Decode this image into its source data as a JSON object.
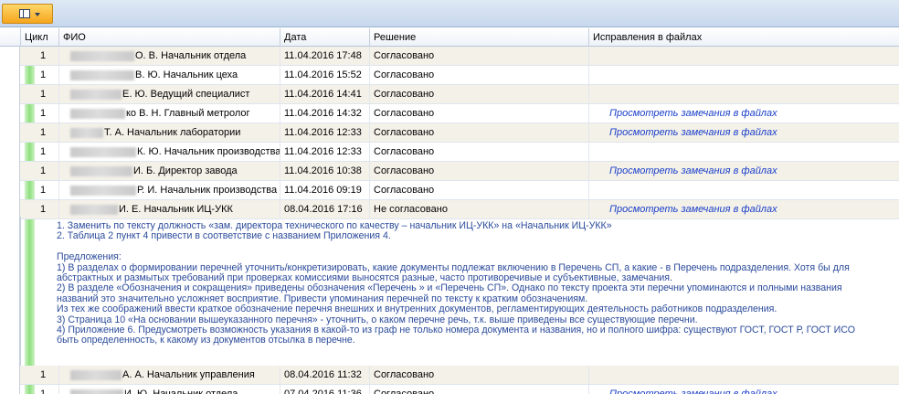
{
  "columns": {
    "cycle": "Цикл",
    "fio": "ФИО",
    "date": "Дата",
    "decision": "Решение",
    "fixes": "Исправления в файлах"
  },
  "rows": [
    {
      "cycle": "1",
      "fio": "О. В. Начальник отдела",
      "date": "11.04.2016 17:48",
      "decision": "Согласовано",
      "fix": ""
    },
    {
      "cycle": "1",
      "fio": "В. Ю. Начальник цеха",
      "date": "11.04.2016 15:52",
      "decision": "Согласовано",
      "fix": ""
    },
    {
      "cycle": "1",
      "fio": "Е. Ю. Ведущий специалист",
      "date": "11.04.2016 14:41",
      "decision": "Согласовано",
      "fix": ""
    },
    {
      "cycle": "1",
      "fio": "ко В. Н. Главный метролог",
      "date": "11.04.2016 14:32",
      "decision": "Согласовано",
      "fix": "Просмотреть замечания в файлах"
    },
    {
      "cycle": "1",
      "fio": "Т. А. Начальник лаборатории",
      "date": "11.04.2016 12:33",
      "decision": "Согласовано",
      "fix": "Просмотреть замечания в файлах"
    },
    {
      "cycle": "1",
      "fio": "К. Ю. Начальник производства",
      "date": "11.04.2016 12:33",
      "decision": "Согласовано",
      "fix": ""
    },
    {
      "cycle": "1",
      "fio": "И. Б. Директор завода",
      "date": "11.04.2016 10:38",
      "decision": "Согласовано",
      "fix": "Просмотреть замечания в файлах"
    },
    {
      "cycle": "1",
      "fio": "Р. И. Начальник производства",
      "date": "11.04.2016 09:19",
      "decision": "Согласовано",
      "fix": ""
    },
    {
      "cycle": "1",
      "fio": "И. Е. Начальник ИЦ-УКК",
      "date": "08.04.2016 17:16",
      "decision": "Не согласовано",
      "fix": "Просмотреть замечания в файлах"
    }
  ],
  "comment_lines": [
    "1. Заменить по тексту должность «зам. директора технического по качеству – начальник ИЦ-УКК» на «Начальник ИЦ-УКК»",
    "2. Таблица 2 пункт 4 привести в соответствие с названием Приложения 4.",
    "",
    "Предложения:",
    "1) В разделах о формировании перечней уточнить/конкретизировать, какие документы подлежат включению в Перечень СП, а какие - в Перечень подразделения. Хотя бы для",
    "абстрактных и размытых требований при проверках комиссиями выносятся разные, часто противоречивые и субъективные, замечания.",
    "2) В разделе «Обозначения и сокращения» приведены обозначения «Перечень       » и «Перечень СП». Однако по тексту проекта эти перечни упоминаются и полными названия",
    "названий это значительно усложняет восприятие. Привести упоминания перечней по тексту к кратким обозначениям.",
    "Из тех же соображений ввести краткое обозначение перечня внешних и внутренних документов, регламентирующих деятельность работников подразделения.",
    "3)  Страница 10 «На основании вышеуказанного перечня» - уточнить, о каком перечне речь, т.к. выше приведены  все существующие перечни.",
    "4) Приложение 6. Предусмотреть возможность указания в какой-то из граф не только номера документа и названия, но и полного шифра:  существуют ГОСТ, ГОСТ Р, ГОСТ ИСО",
    "быть определенность, к какому из документов отсылка в перечне."
  ],
  "rows_after": [
    {
      "cycle": "1",
      "fio": "А. А. Начальник управления",
      "date": "08.04.2016 11:32",
      "decision": "Согласовано",
      "fix": ""
    },
    {
      "cycle": "1",
      "fio": "И. Ю. Начальник отдела",
      "date": "07.04.2016 11:36",
      "decision": "Согласовано",
      "fix": "Просмотреть замечания в файлах"
    }
  ]
}
